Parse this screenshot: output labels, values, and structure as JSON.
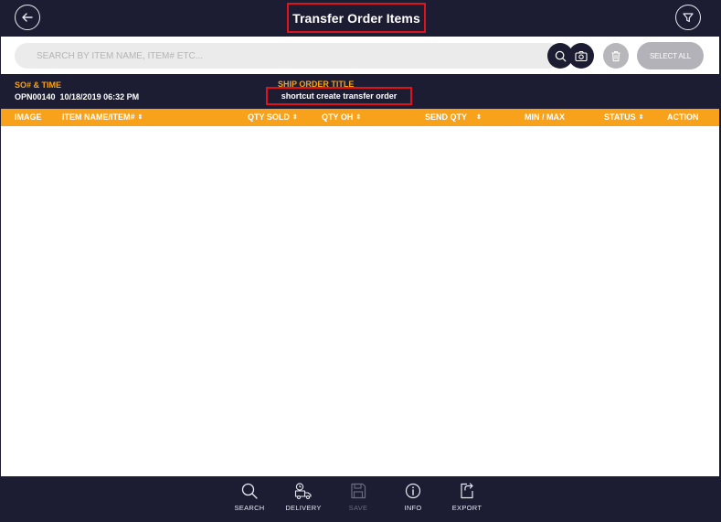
{
  "header": {
    "title": "Transfer Order Items",
    "back_icon": "arrow-left-icon",
    "filter_icon": "filter-icon"
  },
  "search": {
    "placeholder": "SEARCH BY ITEM NAME, ITEM# ETC...",
    "value": ""
  },
  "toolbar": {
    "select_all_label": "SELECT ALL"
  },
  "order": {
    "so_label": "SO# & TIME",
    "so_value": "OPN00140  10/18/2019 06:32 PM",
    "ship_label": "SHIP ORDER TITLE",
    "ship_value": "shortcut create transfer order"
  },
  "table": {
    "columns": [
      {
        "label": "IMAGE",
        "sortable": false
      },
      {
        "label": "ITEM NAME/ITEM#",
        "sortable": true
      },
      {
        "label": "QTY SOLD",
        "sortable": true
      },
      {
        "label": "QTY OH",
        "sortable": true
      },
      {
        "label": "SEND QTY",
        "sortable": true
      },
      {
        "label": "MIN / MAX",
        "sortable": false
      },
      {
        "label": "STATUS",
        "sortable": true
      },
      {
        "label": "ACTION",
        "sortable": false
      }
    ],
    "sort_glyph": "⇕",
    "rows": []
  },
  "footer": {
    "items": [
      {
        "label": "SEARCH",
        "icon": "search-icon",
        "enabled": true
      },
      {
        "label": "DELIVERY",
        "icon": "delivery-truck-icon",
        "enabled": true
      },
      {
        "label": "SAVE",
        "icon": "save-icon",
        "enabled": false
      },
      {
        "label": "INFO",
        "icon": "info-icon",
        "enabled": true
      },
      {
        "label": "EXPORT",
        "icon": "export-icon",
        "enabled": true
      }
    ]
  },
  "colors": {
    "navy": "#1c1d33",
    "accent_orange": "#f7a21a",
    "highlight_red": "#e0121b"
  }
}
